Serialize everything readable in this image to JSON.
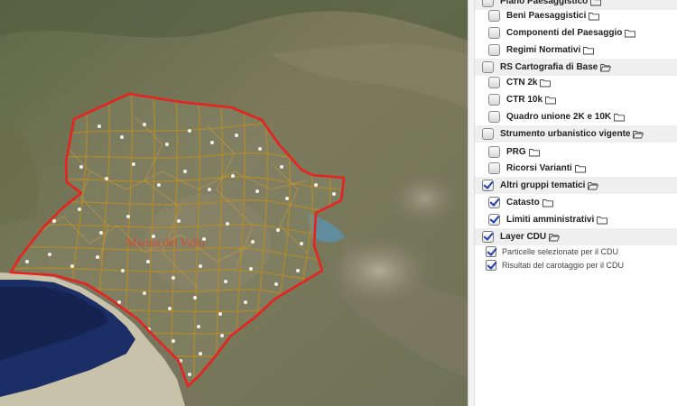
{
  "map": {
    "place_label": "Marina del Vallo",
    "colors": {
      "boundary": "#e8221e",
      "parcels": "#b58a2c",
      "points": "#ffffff",
      "sea": "#1c2e66"
    }
  },
  "layer_tree": {
    "items": [
      {
        "label": "Piano Paesaggistico",
        "level": "group",
        "checked": false,
        "folder": "closed"
      },
      {
        "label": "Beni Paesaggistici",
        "level": "child",
        "checked": false,
        "folder": "closed"
      },
      {
        "label": "Componenti del Paesaggio",
        "level": "child",
        "checked": false,
        "folder": "closed"
      },
      {
        "label": "Regimi Normativi",
        "level": "child",
        "checked": false,
        "folder": "closed"
      },
      {
        "label": "RS Cartografia di Base",
        "level": "group",
        "checked": false,
        "folder": "open"
      },
      {
        "label": "CTN 2k",
        "level": "child",
        "checked": false,
        "folder": "closed"
      },
      {
        "label": "CTR 10k",
        "level": "child",
        "checked": false,
        "folder": "closed"
      },
      {
        "label": "Quadro unione 2K e 10K",
        "level": "child",
        "checked": false,
        "folder": "closed"
      },
      {
        "label": "Strumento urbanistico vigente",
        "level": "group",
        "checked": false,
        "folder": "open"
      },
      {
        "label": "PRG",
        "level": "child",
        "checked": false,
        "folder": "closed"
      },
      {
        "label": "Ricorsi Varianti",
        "level": "child",
        "checked": false,
        "folder": "closed"
      },
      {
        "label": "Altri gruppi tematici",
        "level": "group",
        "checked": true,
        "folder": "open"
      },
      {
        "label": "Catasto",
        "level": "child",
        "checked": true,
        "folder": "closed"
      },
      {
        "label": "Limiti amministrativi",
        "level": "child",
        "checked": true,
        "folder": "closed"
      },
      {
        "label": "Layer CDU",
        "level": "group",
        "checked": true,
        "folder": "open"
      },
      {
        "label": "Particelle selezionate per il CDU",
        "level": "layer",
        "checked": true,
        "folder": "none"
      },
      {
        "label": "Risultati del carotaggio per il CDU",
        "level": "layer",
        "checked": true,
        "folder": "none"
      }
    ]
  }
}
